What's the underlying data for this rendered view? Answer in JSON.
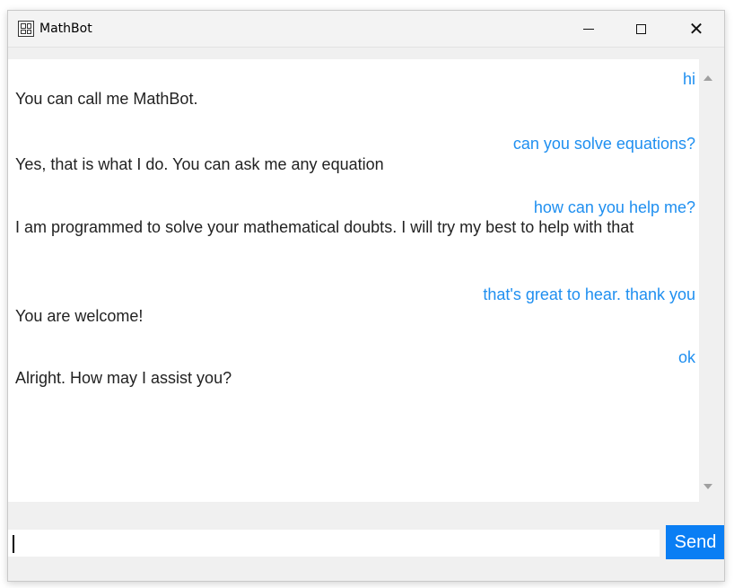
{
  "window": {
    "title": "MathBot",
    "app_icon": "calculator-icon",
    "controls": [
      "minimize-icon",
      "maximize-icon",
      "close-icon"
    ]
  },
  "colors": {
    "user_text": "#1f8ff0",
    "bot_text": "#222222",
    "send_button": "#0a7ef4"
  },
  "chat": {
    "messages": [
      {
        "sender": "user",
        "text": "hi"
      },
      {
        "sender": "bot",
        "text": "You can call me MathBot."
      },
      {
        "sender": "user",
        "text": "can you solve equations?"
      },
      {
        "sender": "bot",
        "text": "Yes, that is what I do. You can ask me any equation"
      },
      {
        "sender": "user",
        "text": "how can you help me?"
      },
      {
        "sender": "bot",
        "text": "I am programmed to solve your mathematical doubts. I will try my best to help with that"
      },
      {
        "sender": "user",
        "text": "that's great to hear. thank you"
      },
      {
        "sender": "bot",
        "text": "You are welcome!"
      },
      {
        "sender": "user",
        "text": "ok"
      },
      {
        "sender": "bot",
        "text": "Alright. How may I assist you?"
      }
    ]
  },
  "input": {
    "value": "",
    "send_label": "Send"
  }
}
